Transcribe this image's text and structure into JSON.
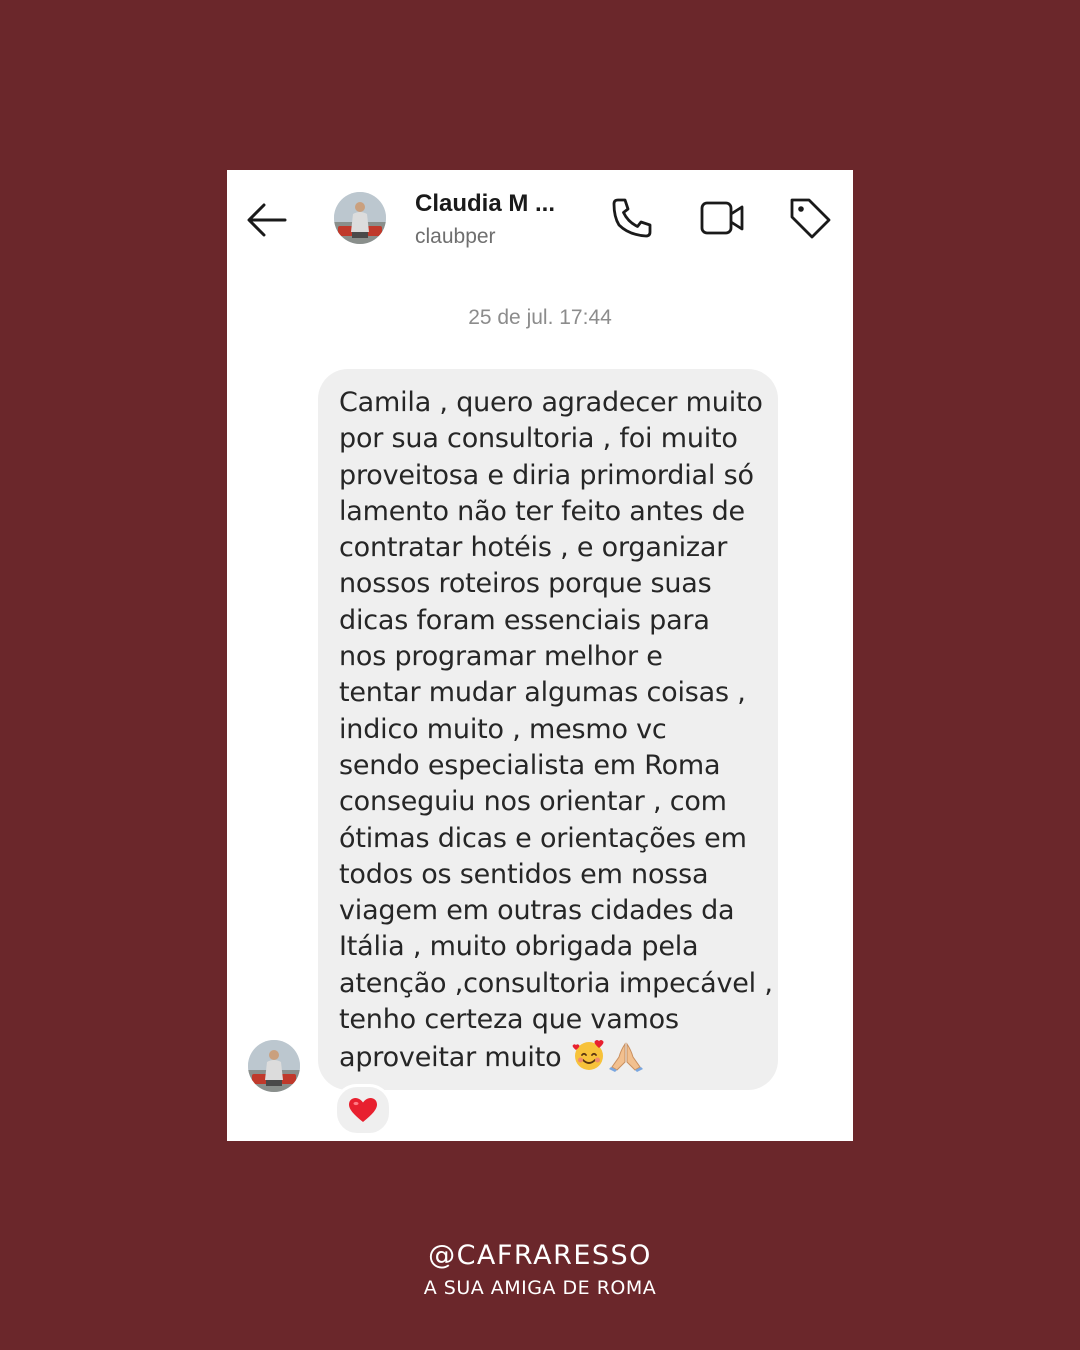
{
  "header": {
    "back_icon": "arrow-left-icon",
    "contact_name": "Claudia M ...",
    "username": "claubper",
    "actions": [
      "phone-icon",
      "video-call-icon",
      "tag-icon"
    ]
  },
  "conversation": {
    "timestamp": "25 de jul. 17:44",
    "message_lines": [
      "Camila , quero agradecer muito",
      "por sua consultoria , foi muito",
      "proveitosa e diria primordial só",
      "lamento não ter feito antes de",
      "contratar hotéis , e organizar",
      "nossos roteiros porque suas",
      "dicas foram essenciais para",
      "nos programar melhor e",
      "tentar mudar algumas coisas ,",
      "indico muito , mesmo vc",
      "sendo especialista em Roma",
      "conseguiu nos orientar , com",
      "ótimas dicas e orientações em",
      "todos os sentidos em nossa",
      "viagem em outras cidades da",
      "Itália , muito obrigada pela",
      "atenção ,consultoria impecável ,",
      "tenho certeza que vamos",
      "aproveitar muito"
    ],
    "message_emojis": [
      "smiling-face-with-hearts-icon",
      "folded-hands-icon"
    ],
    "reaction": "heart-icon"
  },
  "footer": {
    "handle": "@CAFRARESSO",
    "tagline": "A SUA AMIGA DE ROMA"
  },
  "colors": {
    "background": "#6b272b",
    "card": "#ffffff",
    "bubble": "#efefef",
    "heart": "#e8202f"
  }
}
